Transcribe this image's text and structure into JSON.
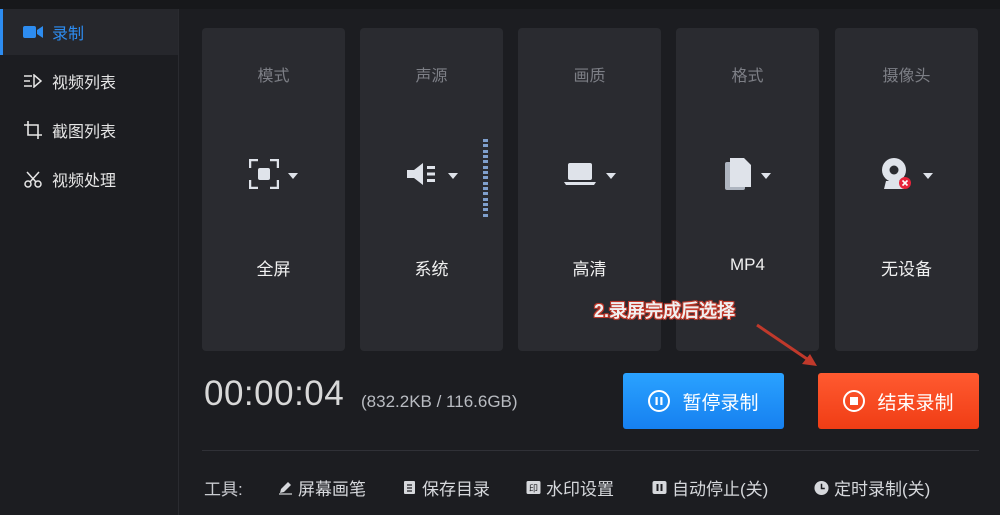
{
  "sidebar": {
    "items": [
      {
        "label": "录制",
        "icon": "video-camera-icon",
        "active": true
      },
      {
        "label": "视频列表",
        "icon": "video-list-icon",
        "active": false
      },
      {
        "label": "截图列表",
        "icon": "screenshot-list-icon",
        "active": false
      },
      {
        "label": "视频处理",
        "icon": "video-tools-icon",
        "active": false
      }
    ]
  },
  "cards": [
    {
      "label": "模式",
      "value": "全屏",
      "icon": "fullscreen-icon"
    },
    {
      "label": "声源",
      "value": "系统",
      "icon": "speaker-icon"
    },
    {
      "label": "画质",
      "value": "高清",
      "icon": "laptop-icon"
    },
    {
      "label": "格式",
      "value": "MP4",
      "icon": "file-icon"
    },
    {
      "label": "摄像头",
      "value": "无设备",
      "icon": "webcam-icon"
    }
  ],
  "timer": "00:00:04",
  "size": "(832.2KB / 116.6GB)",
  "buttons": {
    "pause": "暂停录制",
    "stop": "结束录制"
  },
  "annotation": "2.录屏完成后选择",
  "tools": {
    "title": "工具:",
    "items": [
      {
        "label": "屏幕画笔",
        "icon": "pen-icon"
      },
      {
        "label": "保存目录",
        "icon": "folder-doc-icon"
      },
      {
        "label": "水印设置",
        "icon": "watermark-icon"
      },
      {
        "label": "自动停止(关)",
        "icon": "pause-square-icon"
      },
      {
        "label": "定时录制(关)",
        "icon": "clock-icon"
      }
    ]
  },
  "colors": {
    "accent": "#2d8cf0",
    "stop": "#f03d15",
    "pause": "#1680f0",
    "annotation_arrow": "#c0392b"
  }
}
